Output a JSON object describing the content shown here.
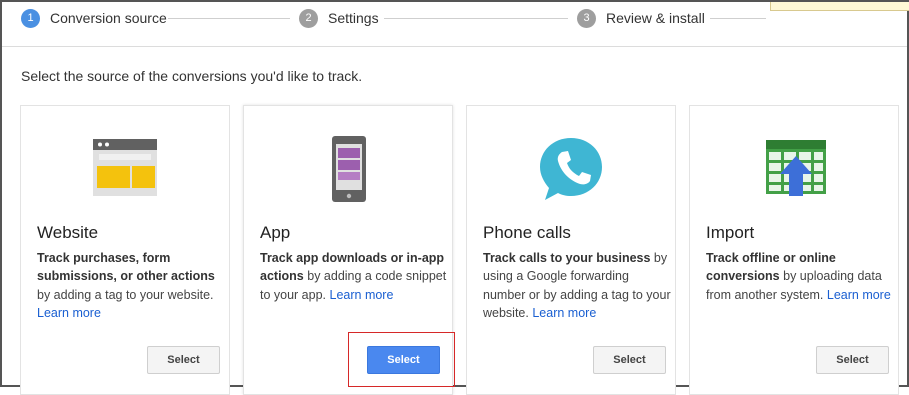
{
  "stepper": {
    "steps": [
      {
        "number": "1",
        "label": "Conversion source",
        "state": "active"
      },
      {
        "number": "2",
        "label": "Settings",
        "state": "inactive"
      },
      {
        "number": "3",
        "label": "Review & install",
        "state": "inactive"
      }
    ]
  },
  "instruction": "Select the source of the conversions you'd like to track.",
  "cards": [
    {
      "icon": "website-browser-icon",
      "title": "Website",
      "desc_bold": "Track purchases, form submissions, or other actions",
      "desc_rest": " by adding a tag to your website. ",
      "link": "Learn more",
      "button": "Select"
    },
    {
      "icon": "mobile-app-icon",
      "title": "App",
      "desc_bold": "Track app downloads or in-app actions",
      "desc_rest": " by adding a code snippet to your app. ",
      "link": "Learn more",
      "button": "Select"
    },
    {
      "icon": "phone-call-icon",
      "title": "Phone calls",
      "desc_bold": "Track calls to your business",
      "desc_rest": " by using a Google forwarding number or by adding a tag to your website. ",
      "link": "Learn more",
      "button": "Select"
    },
    {
      "icon": "import-spreadsheet-icon",
      "title": "Import",
      "desc_bold": "Track offline or online conversions",
      "desc_rest": " by uploading data from another system. ",
      "link": "Learn more",
      "button": "Select"
    }
  ],
  "colors": {
    "accent": "#4a90e2",
    "primary_button": "#4a88ef",
    "link": "#1a5fd1",
    "highlight_border": "#d62828"
  }
}
